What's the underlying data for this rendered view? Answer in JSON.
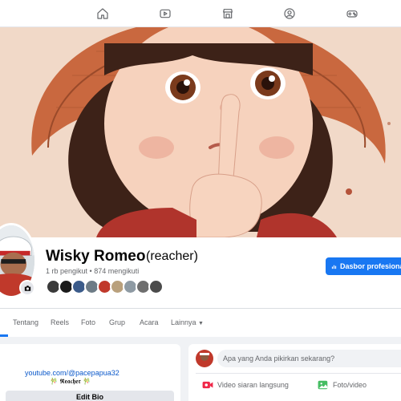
{
  "nav": {
    "items": [
      {
        "icon": "home-icon"
      },
      {
        "icon": "video-icon"
      },
      {
        "icon": "marketplace-icon"
      },
      {
        "icon": "groups-icon"
      },
      {
        "icon": "gaming-icon"
      }
    ]
  },
  "profile": {
    "name": "Wisky Romeo",
    "alternate_name": "(reacher)",
    "stats": "1 rb pengikut • 874 mengikuti",
    "dashboard_label": "Dasbor profesional"
  },
  "tabs": [
    "Tentang",
    "Reels",
    "Foto",
    "Grup",
    "Acara",
    "Lainnya"
  ],
  "intro": {
    "link": "youtube.com/@pacepapua32",
    "bio": "🎋 𝕽𝖊𝖆𝖈𝖍𝖊𝖗 🎋",
    "edit_bio_label": "Edit Bio"
  },
  "composer": {
    "placeholder": "Apa yang Anda pikirkan sekarang?",
    "live_label": "Video siaran langsung",
    "photo_label": "Foto/video"
  },
  "colors": {
    "accent": "#1877f2",
    "live": "#f02849",
    "photo": "#45bd62"
  }
}
